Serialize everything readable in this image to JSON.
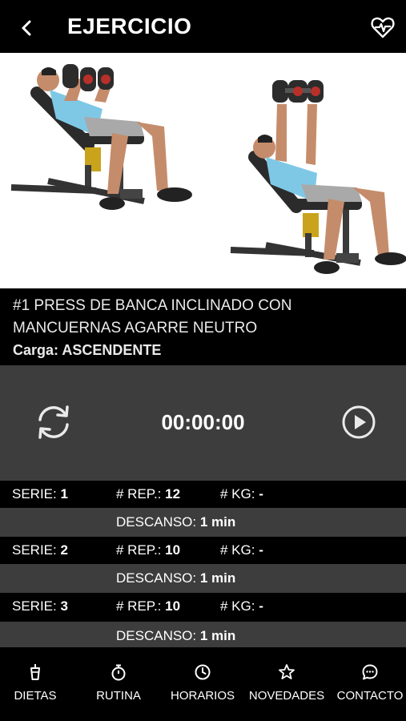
{
  "header": {
    "title": "EJERCICIO",
    "back_icon": "chevron-left-icon",
    "action_icon": "heart-pulse-icon"
  },
  "exercise": {
    "name_line1": "#1 PRESS DE BANCA INCLINADO CON",
    "name_line2": "MANCUERNAS AGARRE NEUTRO",
    "load_label": "Carga:",
    "load_value": "ASCENDENTE"
  },
  "timer": {
    "value": "00:00:00",
    "reset_icon": "refresh-icon",
    "play_icon": "play-circle-icon"
  },
  "sets": [
    {
      "serie_label": "SERIE:",
      "serie": "1",
      "rep_label": "# REP.:",
      "rep": "12",
      "kg_label": "# KG:",
      "kg": "-",
      "rest_label": "DESCANSO:",
      "rest": "1 min"
    },
    {
      "serie_label": "SERIE:",
      "serie": "2",
      "rep_label": "# REP.:",
      "rep": "10",
      "kg_label": "# KG:",
      "kg": "-",
      "rest_label": "DESCANSO:",
      "rest": "1 min"
    },
    {
      "serie_label": "SERIE:",
      "serie": "3",
      "rep_label": "# REP.:",
      "rep": "10",
      "kg_label": "# KG:",
      "kg": "-",
      "rest_label": "DESCANSO:",
      "rest": "1 min"
    }
  ],
  "tabs": [
    {
      "label": "DIETAS",
      "icon": "cup-icon"
    },
    {
      "label": "RUTINA",
      "icon": "stopwatch-icon"
    },
    {
      "label": "HORARIOS",
      "icon": "clock-icon"
    },
    {
      "label": "NOVEDADES",
      "icon": "star-icon"
    },
    {
      "label": "CONTACTO",
      "icon": "chat-icon"
    }
  ],
  "colors": {
    "background": "#000000",
    "panel": "#3d3d3d",
    "text": "#ffffff"
  }
}
